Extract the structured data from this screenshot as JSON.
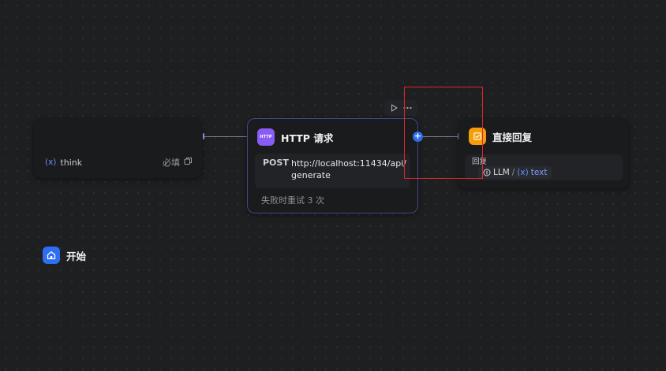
{
  "nodes": {
    "start": {
      "title": "开始",
      "icon": "home-icon",
      "color": "#2f6ef3",
      "variables": [
        {
          "marker": "(x)",
          "name": "think",
          "required_label": "必填"
        }
      ]
    },
    "http": {
      "title": "HTTP 请求",
      "icon_text": "HTTP",
      "color": "#8a5cf6",
      "method": "POST",
      "url": "http://localhost:11434/api/generate",
      "retry_label": "失败时重试 3 次"
    },
    "answer": {
      "title": "直接回复",
      "icon": "reply-icon",
      "color": "#f59e0b",
      "field_label": "回复",
      "value": {
        "source": "LLM",
        "separator": "/",
        "marker": "(x)",
        "var": "text"
      }
    }
  },
  "toolbar": {
    "run_icon": "play-icon",
    "more_icon": "more-icon"
  },
  "edge_color": "#7a7e88",
  "highlight_color": "#e0262b",
  "plus_label": "+"
}
